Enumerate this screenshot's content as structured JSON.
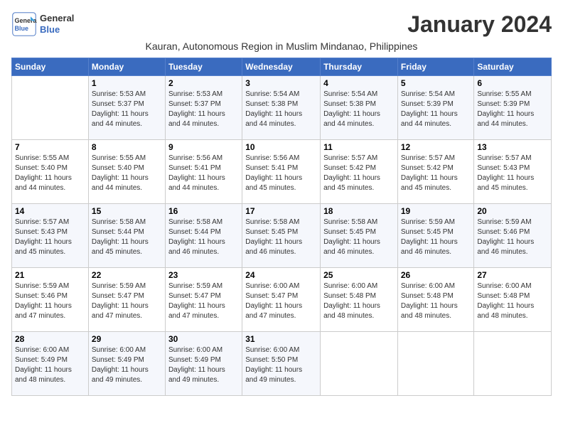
{
  "header": {
    "logo_line1": "General",
    "logo_line2": "Blue",
    "month_title": "January 2024",
    "subtitle": "Kauran, Autonomous Region in Muslim Mindanao, Philippines"
  },
  "days_of_week": [
    "Sunday",
    "Monday",
    "Tuesday",
    "Wednesday",
    "Thursday",
    "Friday",
    "Saturday"
  ],
  "weeks": [
    [
      {
        "day": "",
        "info": ""
      },
      {
        "day": "1",
        "info": "Sunrise: 5:53 AM\nSunset: 5:37 PM\nDaylight: 11 hours\nand 44 minutes."
      },
      {
        "day": "2",
        "info": "Sunrise: 5:53 AM\nSunset: 5:37 PM\nDaylight: 11 hours\nand 44 minutes."
      },
      {
        "day": "3",
        "info": "Sunrise: 5:54 AM\nSunset: 5:38 PM\nDaylight: 11 hours\nand 44 minutes."
      },
      {
        "day": "4",
        "info": "Sunrise: 5:54 AM\nSunset: 5:38 PM\nDaylight: 11 hours\nand 44 minutes."
      },
      {
        "day": "5",
        "info": "Sunrise: 5:54 AM\nSunset: 5:39 PM\nDaylight: 11 hours\nand 44 minutes."
      },
      {
        "day": "6",
        "info": "Sunrise: 5:55 AM\nSunset: 5:39 PM\nDaylight: 11 hours\nand 44 minutes."
      }
    ],
    [
      {
        "day": "7",
        "info": "Sunrise: 5:55 AM\nSunset: 5:40 PM\nDaylight: 11 hours\nand 44 minutes."
      },
      {
        "day": "8",
        "info": "Sunrise: 5:55 AM\nSunset: 5:40 PM\nDaylight: 11 hours\nand 44 minutes."
      },
      {
        "day": "9",
        "info": "Sunrise: 5:56 AM\nSunset: 5:41 PM\nDaylight: 11 hours\nand 44 minutes."
      },
      {
        "day": "10",
        "info": "Sunrise: 5:56 AM\nSunset: 5:41 PM\nDaylight: 11 hours\nand 45 minutes."
      },
      {
        "day": "11",
        "info": "Sunrise: 5:57 AM\nSunset: 5:42 PM\nDaylight: 11 hours\nand 45 minutes."
      },
      {
        "day": "12",
        "info": "Sunrise: 5:57 AM\nSunset: 5:42 PM\nDaylight: 11 hours\nand 45 minutes."
      },
      {
        "day": "13",
        "info": "Sunrise: 5:57 AM\nSunset: 5:43 PM\nDaylight: 11 hours\nand 45 minutes."
      }
    ],
    [
      {
        "day": "14",
        "info": "Sunrise: 5:57 AM\nSunset: 5:43 PM\nDaylight: 11 hours\nand 45 minutes."
      },
      {
        "day": "15",
        "info": "Sunrise: 5:58 AM\nSunset: 5:44 PM\nDaylight: 11 hours\nand 45 minutes."
      },
      {
        "day": "16",
        "info": "Sunrise: 5:58 AM\nSunset: 5:44 PM\nDaylight: 11 hours\nand 46 minutes."
      },
      {
        "day": "17",
        "info": "Sunrise: 5:58 AM\nSunset: 5:45 PM\nDaylight: 11 hours\nand 46 minutes."
      },
      {
        "day": "18",
        "info": "Sunrise: 5:58 AM\nSunset: 5:45 PM\nDaylight: 11 hours\nand 46 minutes."
      },
      {
        "day": "19",
        "info": "Sunrise: 5:59 AM\nSunset: 5:45 PM\nDaylight: 11 hours\nand 46 minutes."
      },
      {
        "day": "20",
        "info": "Sunrise: 5:59 AM\nSunset: 5:46 PM\nDaylight: 11 hours\nand 46 minutes."
      }
    ],
    [
      {
        "day": "21",
        "info": "Sunrise: 5:59 AM\nSunset: 5:46 PM\nDaylight: 11 hours\nand 47 minutes."
      },
      {
        "day": "22",
        "info": "Sunrise: 5:59 AM\nSunset: 5:47 PM\nDaylight: 11 hours\nand 47 minutes."
      },
      {
        "day": "23",
        "info": "Sunrise: 5:59 AM\nSunset: 5:47 PM\nDaylight: 11 hours\nand 47 minutes."
      },
      {
        "day": "24",
        "info": "Sunrise: 6:00 AM\nSunset: 5:47 PM\nDaylight: 11 hours\nand 47 minutes."
      },
      {
        "day": "25",
        "info": "Sunrise: 6:00 AM\nSunset: 5:48 PM\nDaylight: 11 hours\nand 48 minutes."
      },
      {
        "day": "26",
        "info": "Sunrise: 6:00 AM\nSunset: 5:48 PM\nDaylight: 11 hours\nand 48 minutes."
      },
      {
        "day": "27",
        "info": "Sunrise: 6:00 AM\nSunset: 5:48 PM\nDaylight: 11 hours\nand 48 minutes."
      }
    ],
    [
      {
        "day": "28",
        "info": "Sunrise: 6:00 AM\nSunset: 5:49 PM\nDaylight: 11 hours\nand 48 minutes."
      },
      {
        "day": "29",
        "info": "Sunrise: 6:00 AM\nSunset: 5:49 PM\nDaylight: 11 hours\nand 49 minutes."
      },
      {
        "day": "30",
        "info": "Sunrise: 6:00 AM\nSunset: 5:49 PM\nDaylight: 11 hours\nand 49 minutes."
      },
      {
        "day": "31",
        "info": "Sunrise: 6:00 AM\nSunset: 5:50 PM\nDaylight: 11 hours\nand 49 minutes."
      },
      {
        "day": "",
        "info": ""
      },
      {
        "day": "",
        "info": ""
      },
      {
        "day": "",
        "info": ""
      }
    ]
  ]
}
